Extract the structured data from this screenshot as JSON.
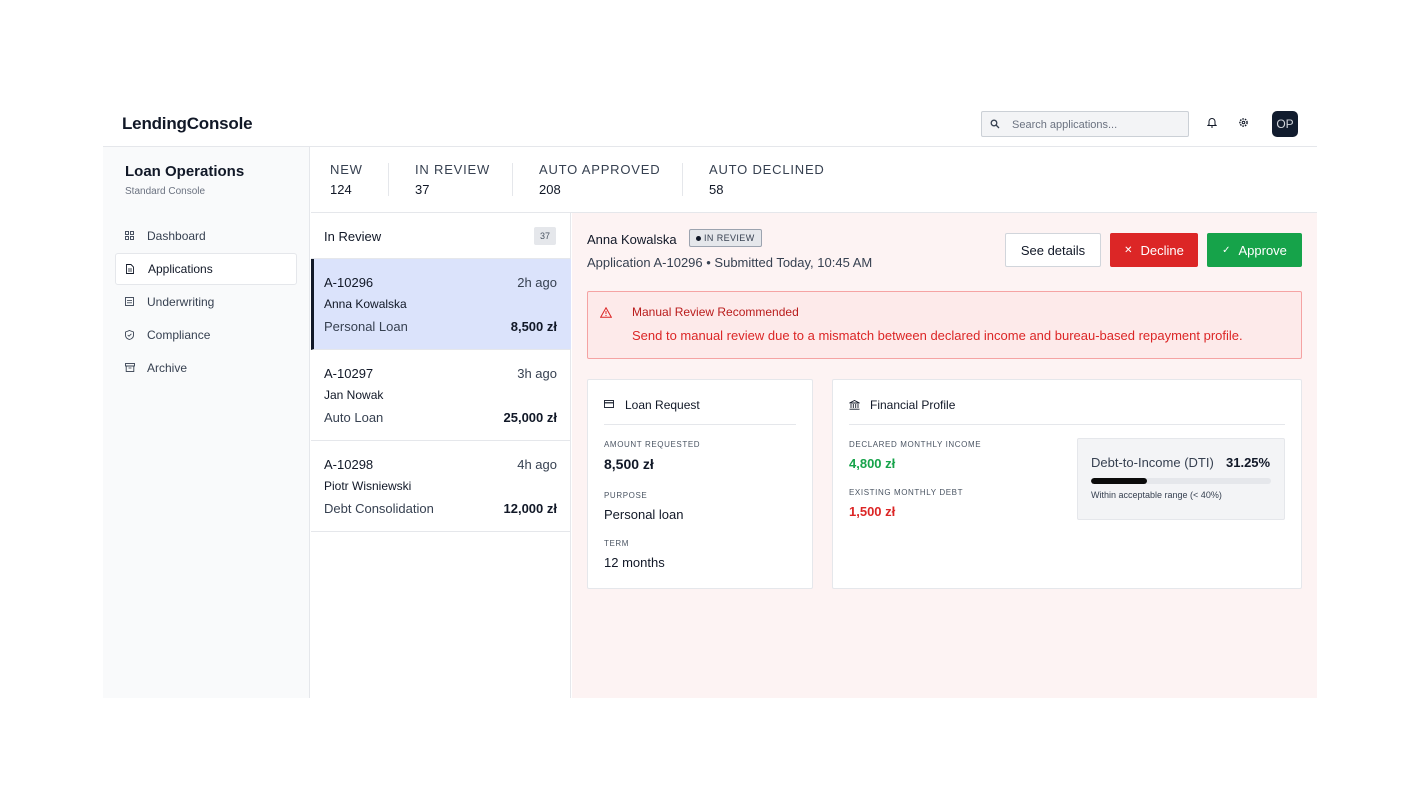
{
  "header": {
    "brand": "LendingConsole",
    "search_placeholder": "Search applications...",
    "avatar_initials": "OP"
  },
  "sidebar": {
    "title": "Loan Operations",
    "subtitle": "Standard Console",
    "items": [
      {
        "label": "Dashboard",
        "icon": "dashboard-icon",
        "active": false
      },
      {
        "label": "Applications",
        "icon": "document-icon",
        "active": true
      },
      {
        "label": "Underwriting",
        "icon": "clipboard-icon",
        "active": false
      },
      {
        "label": "Compliance",
        "icon": "shield-icon",
        "active": false
      },
      {
        "label": "Archive",
        "icon": "archive-icon",
        "active": false
      }
    ]
  },
  "stats": [
    {
      "label": "NEW",
      "value": "124"
    },
    {
      "label": "IN REVIEW",
      "value": "37"
    },
    {
      "label": "AUTO APPROVED",
      "value": "208"
    },
    {
      "label": "AUTO DECLINED",
      "value": "58"
    }
  ],
  "queue": {
    "title": "In Review",
    "count": "37",
    "items": [
      {
        "id": "A-10296",
        "ago": "2h ago",
        "name": "Anna Kowalska",
        "type": "Personal Loan",
        "amount": "8,500 zł",
        "selected": true
      },
      {
        "id": "A-10297",
        "ago": "3h ago",
        "name": "Jan Nowak",
        "type": "Auto Loan",
        "amount": "25,000 zł",
        "selected": false
      },
      {
        "id": "A-10298",
        "ago": "4h ago",
        "name": "Piotr Wisniewski",
        "type": "Debt Consolidation",
        "amount": "12,000 zł",
        "selected": false
      }
    ]
  },
  "detail": {
    "applicant": "Anna Kowalska",
    "status": "IN REVIEW",
    "meta": "Application A-10296  •  Submitted Today, 10:45 AM",
    "buttons": {
      "details": "See details",
      "decline": "Decline",
      "approve": "Approve"
    },
    "alert": {
      "title": "Manual Review Recommended",
      "body": "Send to manual review due to a mismatch between declared income and bureau-based repayment profile."
    },
    "loan_request": {
      "title": "Loan Request",
      "amount_label": "AMOUNT REQUESTED",
      "amount": "8,500 zł",
      "purpose_label": "PURPOSE",
      "purpose": "Personal loan",
      "term_label": "TERM",
      "term": "12 months"
    },
    "financial_profile": {
      "title": "Financial Profile",
      "income_label": "DECLARED MONTHLY INCOME",
      "income": "4,800 zł",
      "debt_label": "EXISTING MONTHLY DEBT",
      "debt": "1,500 zł",
      "dti_label": "Debt-to-Income (DTI)",
      "dti_value": "31.25%",
      "dti_fraction": 0.3125,
      "dti_note": "Within acceptable range (< 40%)"
    }
  },
  "colors": {
    "decline": "#dc2626",
    "approve": "#16a34a",
    "selected_row": "#dbe3fb",
    "alert_bg": "#fdeaea"
  }
}
